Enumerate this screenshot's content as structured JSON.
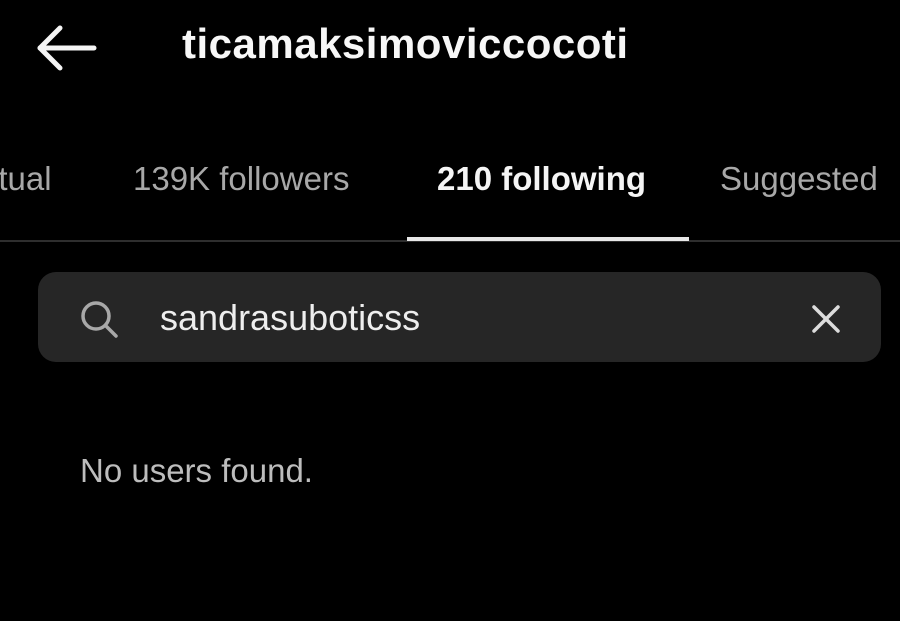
{
  "header": {
    "title": "ticamaksimoviccocoti",
    "back_icon": "back-arrow-icon"
  },
  "tabs": [
    {
      "label": "utual",
      "active": false
    },
    {
      "label": "139K followers",
      "active": false
    },
    {
      "label": "210 following",
      "active": true
    },
    {
      "label": "Suggested",
      "active": false
    }
  ],
  "search": {
    "value": "sandrasuboticss",
    "icon": "search-icon",
    "clear_icon": "close-icon"
  },
  "results": {
    "empty_message": "No users found."
  },
  "colors": {
    "background": "#000000",
    "search_field": "#262626",
    "active_text": "#f5f5f5",
    "inactive_text": "#a8a8a8"
  }
}
